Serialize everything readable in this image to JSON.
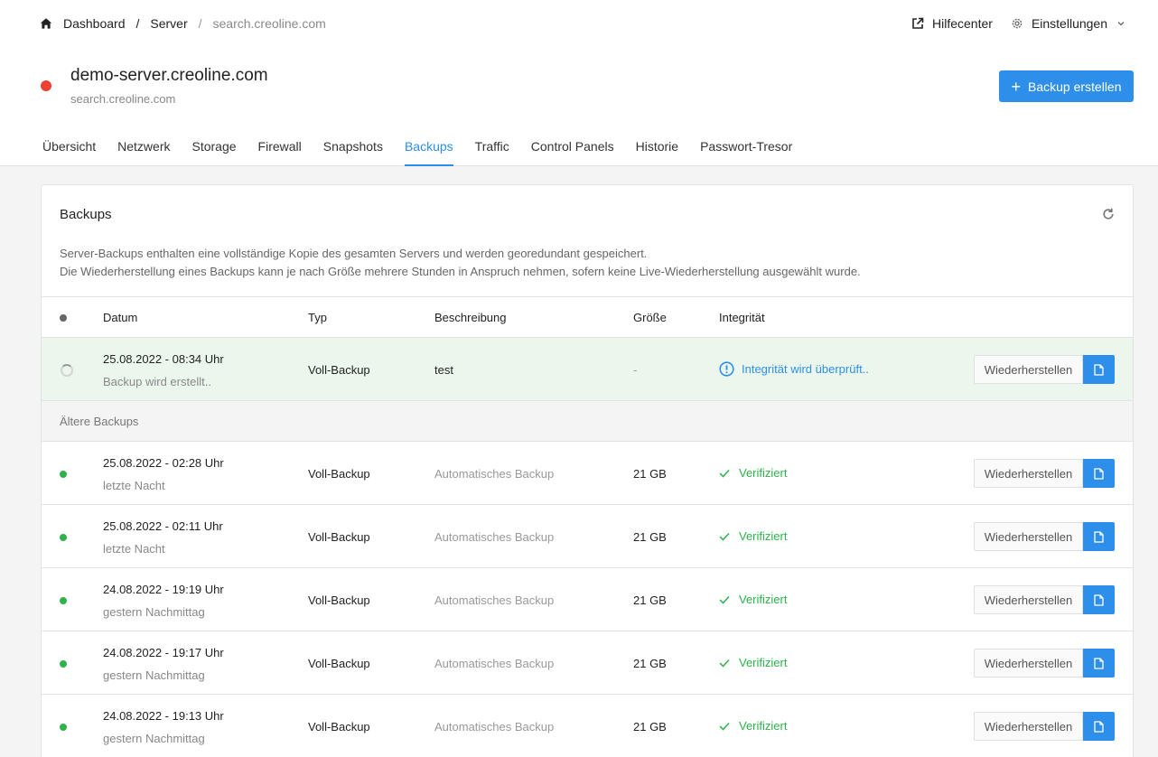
{
  "breadcrumb": {
    "home_icon": "home-icon",
    "items": [
      "Dashboard",
      "Server",
      "search.creoline.com"
    ],
    "separator": "/"
  },
  "header_links": {
    "help": "Hilfecenter",
    "settings": "Einstellungen"
  },
  "server": {
    "name": "demo-server.creoline.com",
    "host": "search.creoline.com",
    "status_color": "#ee4035"
  },
  "actions": {
    "create_backup": "Backup erstellen"
  },
  "tabs": [
    {
      "label": "Übersicht",
      "active": false
    },
    {
      "label": "Netzwerk",
      "active": false
    },
    {
      "label": "Storage",
      "active": false
    },
    {
      "label": "Firewall",
      "active": false
    },
    {
      "label": "Snapshots",
      "active": false
    },
    {
      "label": "Backups",
      "active": true
    },
    {
      "label": "Traffic",
      "active": false
    },
    {
      "label": "Control Panels",
      "active": false
    },
    {
      "label": "Historie",
      "active": false
    },
    {
      "label": "Passwort-Tresor",
      "active": false
    }
  ],
  "card": {
    "title": "Backups",
    "description_1": "Server-Backups enthalten eine vollständige Kopie des gesamten Servers und werden georedundant gespeichert.",
    "description_2": "Die Wiederherstellung eines Backups kann je nach Größe mehrere Stunden in Anspruch nehmen, sofern keine Live-Wiederherstellung ausgewählt wurde."
  },
  "table": {
    "headers": {
      "date": "Datum",
      "type": "Typ",
      "description": "Beschreibung",
      "size": "Größe",
      "integrity": "Integrität"
    },
    "restore_label": "Wiederherstellen",
    "pending": {
      "date": "25.08.2022 - 08:34 Uhr",
      "relative": "Backup wird erstellt..",
      "type": "Voll-Backup",
      "description": "test",
      "size": "-",
      "integrity": "Integrität wird überprüft.."
    },
    "section_label": "Ältere Backups",
    "rows": [
      {
        "date": "25.08.2022 - 02:28 Uhr",
        "relative": "letzte Nacht",
        "type": "Voll-Backup",
        "description": "Automatisches Backup",
        "size": "21 GB",
        "integrity": "Verifiziert"
      },
      {
        "date": "25.08.2022 - 02:11 Uhr",
        "relative": "letzte Nacht",
        "type": "Voll-Backup",
        "description": "Automatisches Backup",
        "size": "21 GB",
        "integrity": "Verifiziert"
      },
      {
        "date": "24.08.2022 - 19:19 Uhr",
        "relative": "gestern Nachmittag",
        "type": "Voll-Backup",
        "description": "Automatisches Backup",
        "size": "21 GB",
        "integrity": "Verifiziert"
      },
      {
        "date": "24.08.2022 - 19:17 Uhr",
        "relative": "gestern Nachmittag",
        "type": "Voll-Backup",
        "description": "Automatisches Backup",
        "size": "21 GB",
        "integrity": "Verifiziert"
      },
      {
        "date": "24.08.2022 - 19:13 Uhr",
        "relative": "gestern Nachmittag",
        "type": "Voll-Backup",
        "description": "Automatisches Backup",
        "size": "21 GB",
        "integrity": "Verifiziert"
      }
    ]
  },
  "colors": {
    "accent": "#2d8fe9",
    "success": "#2db34a",
    "danger": "#ee4035",
    "pending_row_bg": "#ebf7ed"
  }
}
